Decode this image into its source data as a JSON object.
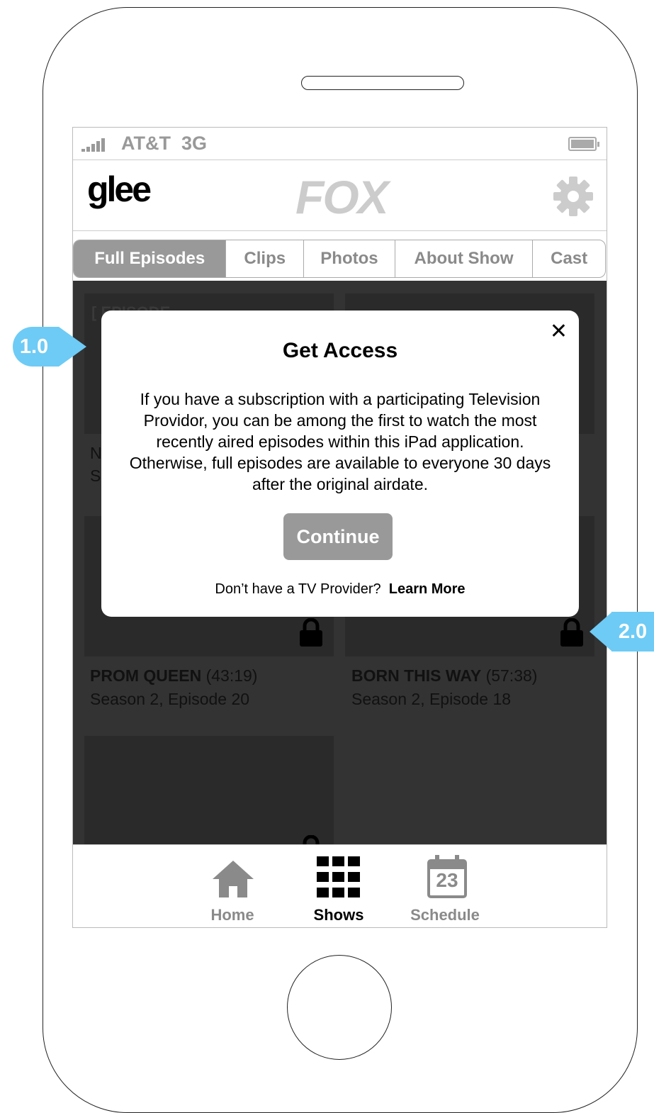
{
  "status_bar": {
    "carrier": "AT&T",
    "network": "3G"
  },
  "header": {
    "show_logo": "glee",
    "network_logo": "FOX",
    "settings_icon": "gear-icon"
  },
  "tabs": [
    {
      "label": "Full Episodes",
      "active": true
    },
    {
      "label": "Clips",
      "active": false
    },
    {
      "label": "Photos",
      "active": false
    },
    {
      "label": "About Show",
      "active": false
    },
    {
      "label": "Cast",
      "active": false
    }
  ],
  "episodes": [
    {
      "title": "PROM QUEEN",
      "duration": "(43:19)",
      "subtitle": "Season 2, Episode 20",
      "locked": true
    },
    {
      "title": "BORN THIS WAY",
      "duration": "(57:38)",
      "subtitle": "Season 2, Episode 18",
      "locked": true
    }
  ],
  "partial_labels": {
    "left_title_initial": "N",
    "left_sub_initial": "S"
  },
  "modal": {
    "title": "Get Access",
    "body": "If you have a subscription with a participating Television Providor, you can be among the first to watch the most recently aired episodes within this iPad application. Otherwise, full episodes are available to everyone 30 days after the original airdate.",
    "button": "Continue",
    "footer_prompt": "Don’t have a TV Provider?",
    "footer_link": "Learn More",
    "close_glyph": "✕"
  },
  "tab_bar": [
    {
      "label": "Home",
      "icon": "home-icon",
      "active": false
    },
    {
      "label": "Shows",
      "icon": "grid-icon",
      "active": true
    },
    {
      "label": "Schedule",
      "icon": "calendar-icon",
      "active": false,
      "icon_text": "23"
    }
  ],
  "callouts": {
    "first": "1.0",
    "second": "2.0"
  },
  "colors": {
    "callout": "#6ecbf5",
    "active_tab": "#999999",
    "content_bg": "#333333"
  }
}
